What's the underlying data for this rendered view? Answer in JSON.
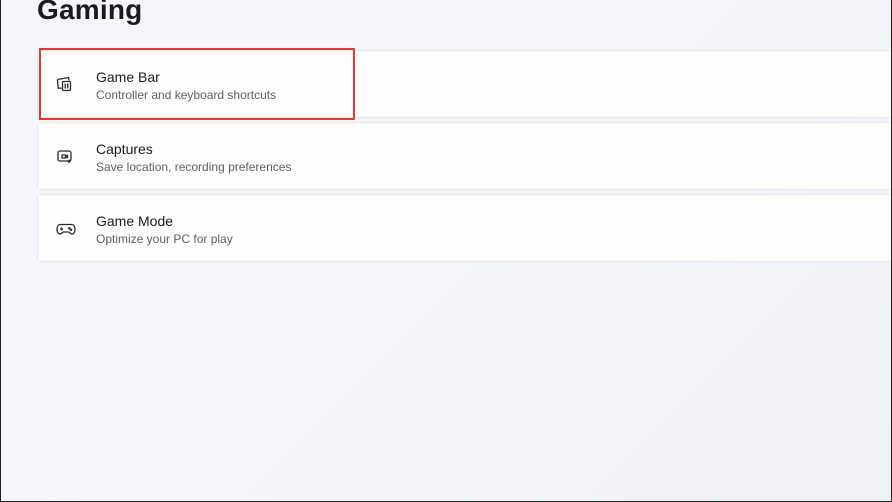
{
  "page": {
    "title": "Gaming"
  },
  "settings": [
    {
      "title": "Game Bar",
      "subtitle": "Controller and keyboard shortcuts",
      "icon": "game-bar-icon"
    },
    {
      "title": "Captures",
      "subtitle": "Save location, recording preferences",
      "icon": "captures-icon"
    },
    {
      "title": "Game Mode",
      "subtitle": "Optimize your PC for play",
      "icon": "controller-icon"
    }
  ],
  "colors": {
    "highlight": "#e53935",
    "card_bg": "#fdfdfe",
    "text_primary": "#1b1b1b",
    "text_secondary": "#5f5f5f"
  }
}
